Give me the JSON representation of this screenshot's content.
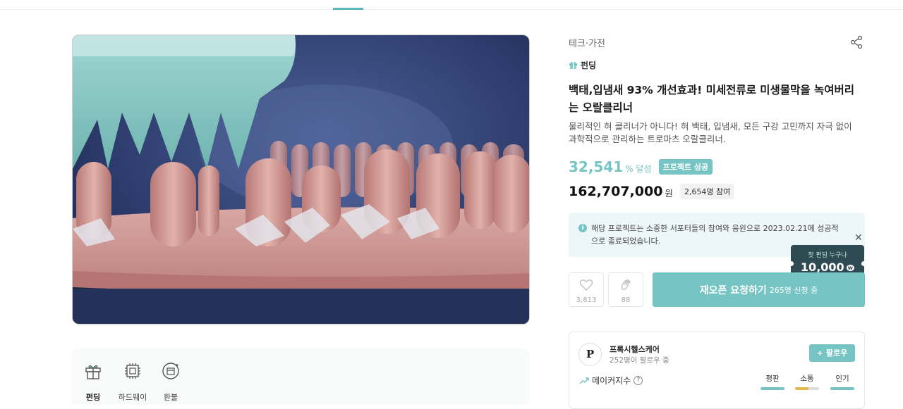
{
  "page": {
    "title": "백태,입냄새 93% 개선효과! 미세전류로 미생물막을 녹여버리는 오랄클리너"
  },
  "hero_image": {
    "alt": "product image"
  },
  "benefits": [
    {
      "label": "펀딩",
      "icon": "gift-icon",
      "active": true
    },
    {
      "label": "하드웨이",
      "icon": "chip-icon",
      "active": false
    },
    {
      "label": "환불",
      "icon": "refund-icon",
      "active": false
    }
  ],
  "project": {
    "category": "테크·가전",
    "type_label": "펀딩",
    "title": "백태,입냄새 93% 개선효과! 미세전류로 미생물막을 녹여버리는 오랄클리너",
    "description": "물리적인 혀 클리너가 아니다! 혀 백태, 입냄새, 모든 구강 고민까지 자극 없이 과학적으로 관리하는 트로마츠 오랄클리너.",
    "achievement_rate": "32,541",
    "achievement_unit": "% 달성",
    "status_badge": "프로젝트 성공",
    "amount": "162,707,000",
    "amount_unit": "원",
    "supporters": "2,654명 참여"
  },
  "notice": {
    "text": "해당 프로젝트는 소중한 서포터들의 참여와 응원으로 2023.02.21에 성공적으로 종료되었습니다."
  },
  "coupon": {
    "label": "첫 펀딩 누구나",
    "amount": "10,000",
    "unit": "w"
  },
  "actions": {
    "like_count": "3,813",
    "cheer_count": "88",
    "reopen_label": "재오픈 요청하기",
    "reopen_sub": "265명 신청 중"
  },
  "maker": {
    "logo_letter": "P",
    "name": "프록시헬스케어",
    "followers": "252명이 팔로우 중",
    "follow_label": "팔로우",
    "index_label": "메이커지수",
    "metrics": [
      {
        "label": "평판",
        "level": 1.0,
        "color": "#76c4c4"
      },
      {
        "label": "소통",
        "level": 0.55,
        "color": "#e8b94a"
      },
      {
        "label": "인기",
        "level": 1.0,
        "color": "#76c4c4"
      }
    ]
  },
  "colors": {
    "accent": "#76c4c4",
    "coupon_bg": "#2e4a52",
    "notice_bg": "#edf6f8"
  }
}
